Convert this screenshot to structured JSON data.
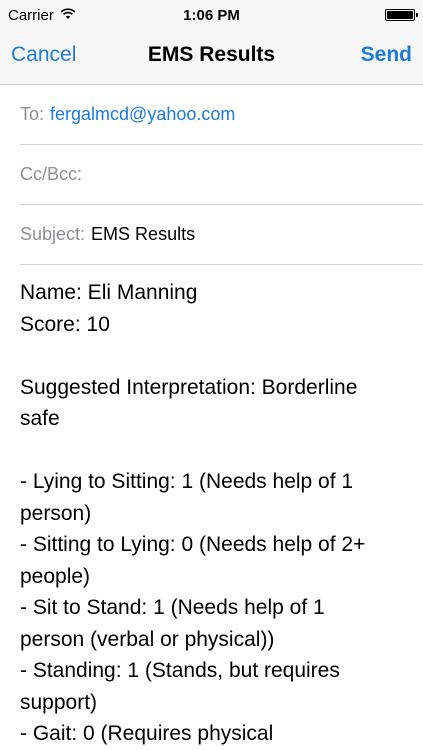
{
  "status_bar": {
    "carrier": "Carrier",
    "time": "1:06 PM"
  },
  "nav": {
    "cancel_label": "Cancel",
    "title": "EMS Results",
    "send_label": "Send"
  },
  "fields": {
    "to_label": "To:",
    "to_value": "fergalmcd@yahoo.com",
    "ccbcc_label": "Cc/Bcc:",
    "subject_label": "Subject:",
    "subject_value": "EMS Results"
  },
  "body_lines": [
    "Name: Eli Manning",
    "Score: 10",
    "",
    "Suggested Interpretation: Borderline",
    "safe",
    "",
    "- Lying to Sitting: 1 (Needs help of 1",
    "person)",
    "- Sitting to Lying: 0 (Needs help of 2+",
    "people)",
    "- Sit to Stand: 1 (Needs help of 1",
    "person (verbal or physical))",
    "- Standing: 1 (Stands, but requires",
    "support)",
    "- Gait: 0 (Requires physical"
  ]
}
